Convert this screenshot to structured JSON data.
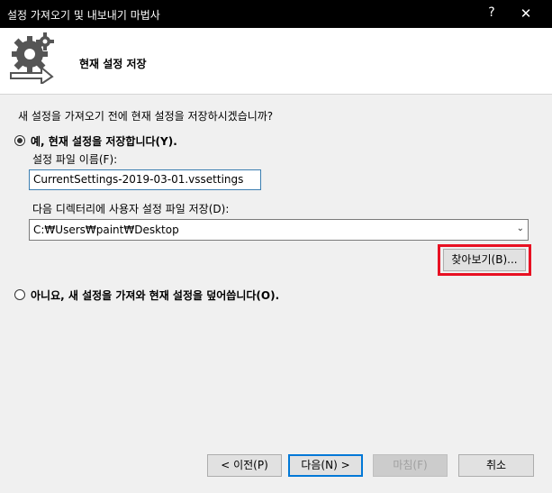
{
  "window": {
    "title": "설정 가져오기 및 내보내기 마법사",
    "help_label": "?",
    "close_label": "✕"
  },
  "header": {
    "title": "현재 설정 저장",
    "logo_icon": "gear-arrow-icon"
  },
  "main": {
    "question": "새 설정을 가져오기 전에 현재 설정을 저장하시겠습니까?",
    "option_yes": {
      "label": "예, 현재 설정을 저장합니다(Y).",
      "selected": true
    },
    "filename_label": "설정 파일 이름(F):",
    "filename_value": "CurrentSettings-2019-03-01.vssettings",
    "directory_label": "다음 디렉터리에 사용자 설정 파일 저장(D):",
    "directory_value": "C:₩Users₩paint₩Desktop",
    "browse_label": "찾아보기(B)...",
    "option_no": {
      "label": "아니요, 새 설정을 가져와 현재 설정을 덮어씁니다(O).",
      "selected": false
    }
  },
  "footer": {
    "prev_label": "< 이전(P)",
    "next_label": "다음(N) >",
    "finish_label": "마침(F)",
    "cancel_label": "취소"
  },
  "colors": {
    "titlebar": "#000000",
    "highlight": "#e81123",
    "focus": "#0078d7"
  }
}
